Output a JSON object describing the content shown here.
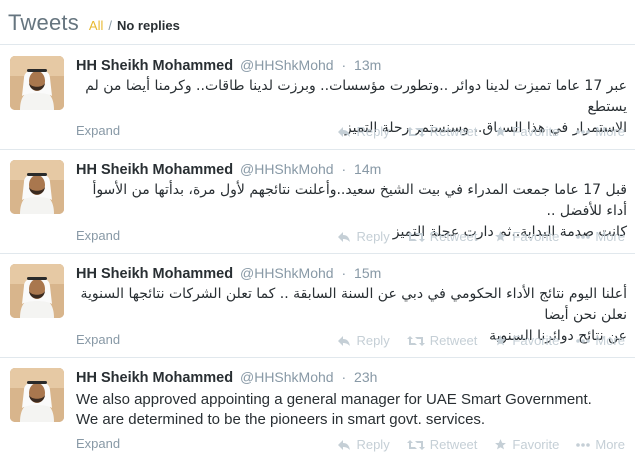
{
  "header": {
    "title": "Tweets",
    "filter_all": "All",
    "filter_sep": "/",
    "filter_noreplies": "No replies"
  },
  "colors": {
    "filter_accent": "#e8b930",
    "muted": "#8899a6",
    "action_gray": "#c5cfd6",
    "text": "#292f33"
  },
  "actions": {
    "reply": "Reply",
    "retweet": "Retweet",
    "favorite": "Favorite",
    "more": "More",
    "expand": "Expand"
  },
  "icons": [
    "reply-icon",
    "retweet-icon",
    "favorite-icon",
    "more-icon"
  ],
  "tweets": [
    {
      "fullname": "HH Sheikh Mohammed",
      "username": "@HHShkMohd",
      "dot": "·",
      "time": "13m",
      "lang": "ar",
      "text_lines": [
        "عبر 17 عاما تميزت لدينا دوائر ..وتطورت مؤسسات.. وبرزت لدينا طاقات.. وكرمنا أيضا من لم يستطع",
        "الاستمرار في هذا السباق.. وسنستمر رحلة التميز"
      ]
    },
    {
      "fullname": "HH Sheikh Mohammed",
      "username": "@HHShkMohd",
      "dot": "·",
      "time": "14m",
      "lang": "ar",
      "text_lines": [
        "قبل 17 عاما جمعت المدراء في بيت الشيخ سعيد..وأعلنت نتائجهم لأول مرة، بدأتها من الأسوأ أداء للأفضل ..",
        "كانت صدمة البداية..ثم دارت عجلة التميز"
      ]
    },
    {
      "fullname": "HH Sheikh Mohammed",
      "username": "@HHShkMohd",
      "dot": "·",
      "time": "15m",
      "lang": "ar",
      "text_lines": [
        "أعلنا اليوم نتائج الأداء الحكومي في دبي عن السنة السابقة .. كما تعلن الشركات نتائجها السنوية نعلن نحن أيضا",
        "عن نتائج دوائرنا السنوية"
      ]
    },
    {
      "fullname": "HH Sheikh Mohammed",
      "username": "@HHShkMohd",
      "dot": "·",
      "time": "23h",
      "lang": "en",
      "text_lines": [
        "We also approved appointing a general manager for UAE Smart Government.",
        "We are determined to be the pioneers in smart govt. services."
      ]
    }
  ]
}
